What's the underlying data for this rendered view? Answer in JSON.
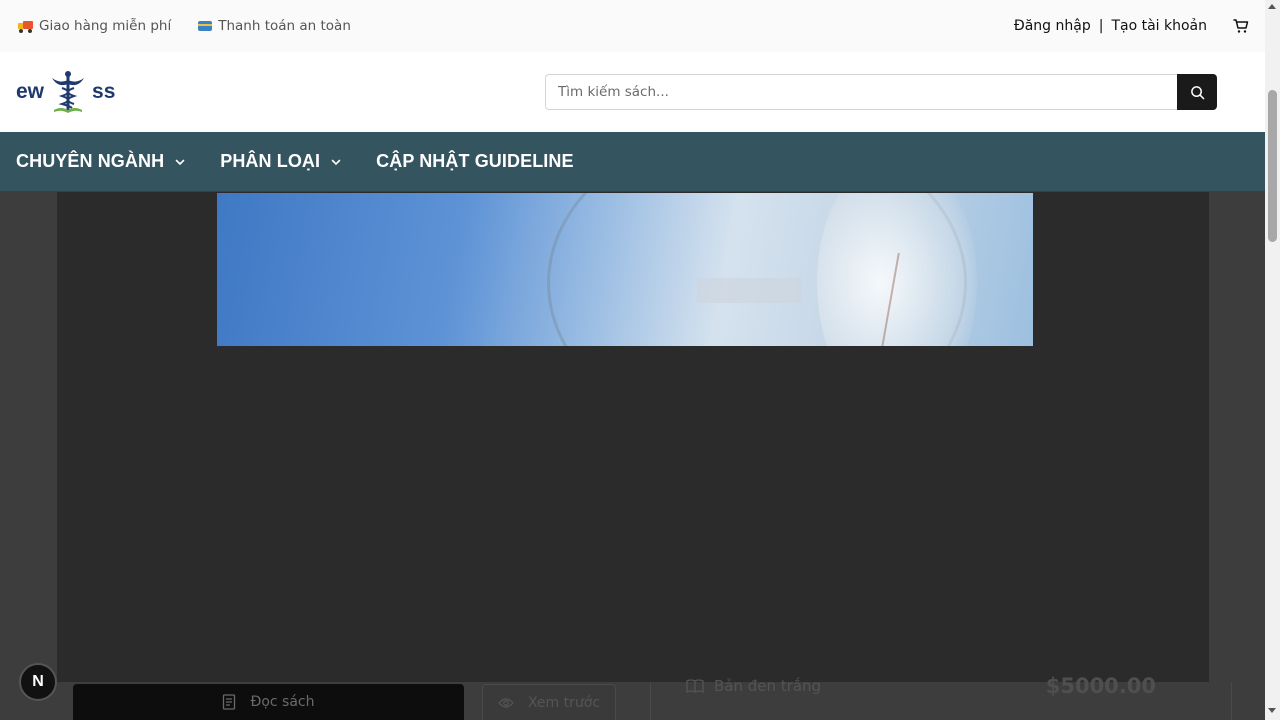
{
  "topbar": {
    "perks": [
      {
        "icon": "truck-icon",
        "label": "Giao hàng miễn phí"
      },
      {
        "icon": "credit-card-icon",
        "label": "Thanh toán an toàn"
      }
    ],
    "login_label": "Đăng nhập",
    "separator": "|",
    "register_label": "Tạo tài khoản",
    "cart_icon": "cart-icon"
  },
  "header": {
    "logo": {
      "left_text": "ew",
      "right_text": "ss",
      "icon": "caduceus-icon"
    },
    "search": {
      "placeholder": "Tìm kiếm sách...",
      "value": "",
      "button_icon": "search-icon"
    }
  },
  "nav": {
    "items": [
      {
        "label": "CHUYÊN NGÀNH",
        "has_dropdown": true
      },
      {
        "label": "PHÂN LOẠI",
        "has_dropdown": true
      },
      {
        "label": "CẬP NHẬT GUIDELINE",
        "has_dropdown": false
      }
    ]
  },
  "product": {
    "read_button_label": "Đọc sách",
    "preview_button_label": "Xem trước",
    "format_label": "Bản đen trắng",
    "price": "$5000.00"
  },
  "badge": {
    "letter": "N"
  },
  "colors": {
    "nav_bg": "#34545f",
    "overlay_bg": "#2b2b2b",
    "page_bg": "#3d3d3d",
    "logo_text": "#1e3a6e",
    "search_button": "#1a1a1a"
  }
}
